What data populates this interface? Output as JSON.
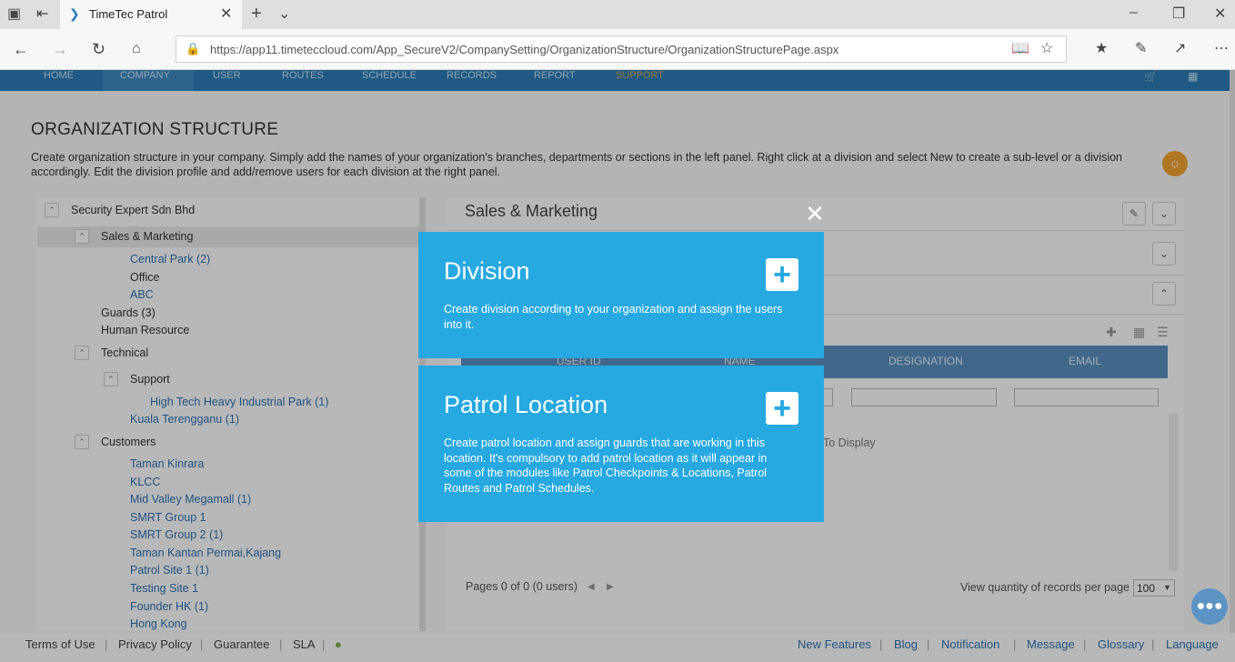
{
  "browser": {
    "tab_title": "TimeTec Patrol",
    "url": "https://app11.timeteccloud.com/App_SecureV2/CompanySetting/OrganizationStructure/OrganizationStructurePage.aspx"
  },
  "nav": {
    "items": [
      "HOME",
      "COMPANY",
      "USER",
      "ROUTES",
      "SCHEDULE",
      "RECORDS",
      "REPORT",
      "SUPPORT"
    ],
    "active": "COMPANY"
  },
  "page": {
    "title": "ORGANIZATION STRUCTURE",
    "description": "Create organization structure in your company. Simply add the names of your organization's branches, departments or sections in the left panel. Right click at a division and select New to create a sub-level or a division accordingly. Edit the division profile and add/remove users for each division at the right panel."
  },
  "tree": {
    "root": "Security Expert Sdn Bhd",
    "sales": "Sales & Marketing",
    "central_park": "Central Park (2)",
    "office": "Office",
    "abc": "ABC",
    "guards": "Guards (3)",
    "hr": "Human Resource",
    "technical": "Technical",
    "support": "Support",
    "high_tech": "High Tech Heavy Industrial Park (1)",
    "kuala": "Kuala Terengganu (1)",
    "customers": "Customers",
    "taman_kinrara": "Taman Kinrara",
    "klcc": "KLCC",
    "mid_valley": "Mid Valley Megamall (1)",
    "smrt1": "SMRT Group 1",
    "smrt2": "SMRT Group 2 (1)",
    "taman_kantan": "Taman Kantan Permai,Kajang",
    "patrol_site": "Patrol Site 1 (1)",
    "testing_site": "Testing Site 1",
    "founder": "Founder HK (1)",
    "hong_kong": "Hong Kong"
  },
  "detail": {
    "title": "Sales & Marketing",
    "columns": [
      "USER ID",
      "NAME",
      "DESIGNATION",
      "EMAIL"
    ],
    "empty_text": "To Display",
    "pager_text": "Pages 0 of 0 (0 users)",
    "per_page_label": "View quantity of records per page",
    "per_page_value": "100"
  },
  "modal": {
    "division": {
      "title": "Division",
      "desc": "Create division according to your organization and assign the users into it."
    },
    "patrol": {
      "title": "Patrol Location",
      "desc": "Create patrol location and assign guards that are working in this location. It's compulsory to add patrol location as it will appear in some of the modules like Patrol Checkpoints & Locations, Patrol Routes and Patrol Schedules."
    }
  },
  "footer": {
    "left": [
      "Terms of Use",
      "Privacy Policy",
      "Guarantee",
      "SLA"
    ],
    "right": [
      "New Features",
      "Blog",
      "Notification",
      "Message",
      "Glossary",
      "Language"
    ]
  },
  "colors": {
    "modal_card": "#27a8e0",
    "nav_bar": "#2b7cb8",
    "link": "#2f73b6"
  }
}
